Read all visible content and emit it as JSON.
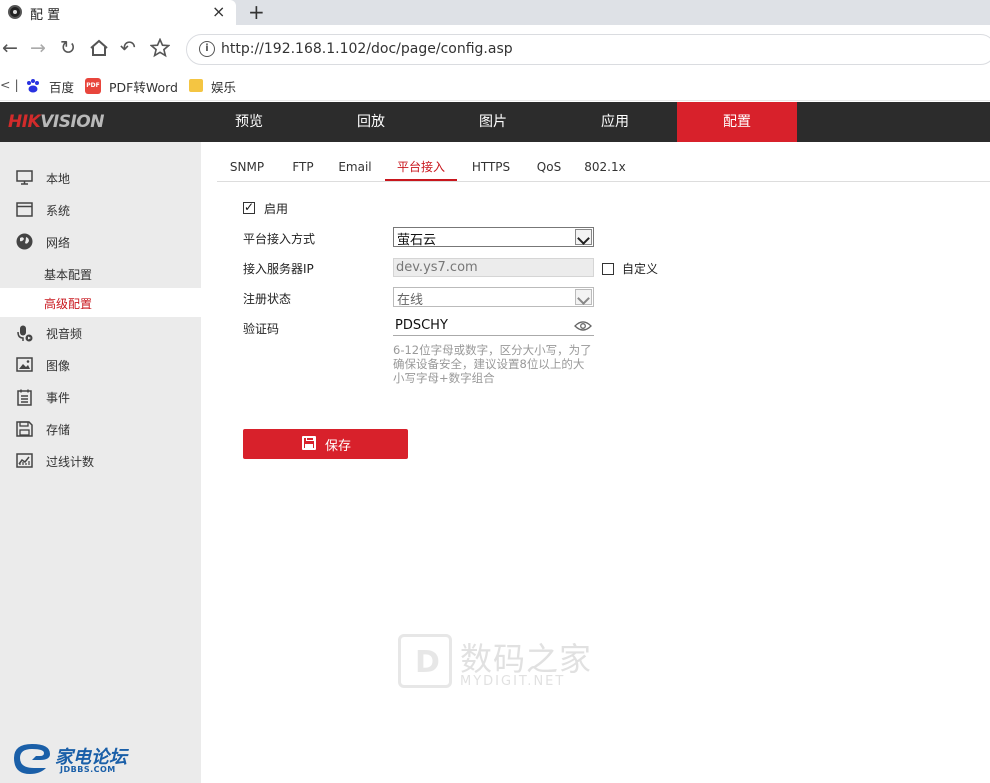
{
  "browser": {
    "tab_title": "配 置",
    "tab_close": "×",
    "new_tab": "+",
    "url": "http://192.168.1.102/doc/page/config.asp",
    "bookmarks": [
      "百度",
      "PDF转Word",
      "娱乐"
    ],
    "bookmark_collapse": "< |"
  },
  "app": {
    "logo_red": "HIK",
    "logo_gray": "VISION",
    "nav": [
      "预览",
      "回放",
      "图片",
      "应用",
      "配置"
    ],
    "nav_active": "配置"
  },
  "sidebar": {
    "items": [
      {
        "label": "本地",
        "icon": "monitor-icon"
      },
      {
        "label": "系统",
        "icon": "window-icon"
      },
      {
        "label": "网络",
        "icon": "globe-icon"
      },
      {
        "label": "基本配置",
        "sub": true
      },
      {
        "label": "高级配置",
        "sub": true,
        "active": true
      },
      {
        "label": "视音频",
        "icon": "mic-icon"
      },
      {
        "label": "图像",
        "icon": "image-icon"
      },
      {
        "label": "事件",
        "icon": "list-icon"
      },
      {
        "label": "存储",
        "icon": "disk-icon"
      },
      {
        "label": "过线计数",
        "icon": "chart-icon"
      }
    ],
    "footer_logo": "家电论坛",
    "footer_sub": "JDBBS.COM"
  },
  "subtabs": {
    "items": [
      "SNMP",
      "FTP",
      "Email",
      "平台接入",
      "HTTPS",
      "QoS",
      "802.1x"
    ],
    "active": "平台接入"
  },
  "form": {
    "enable_label": "启用",
    "enable_checked": true,
    "platform_label": "平台接入方式",
    "platform_value": "萤石云",
    "server_label": "接入服务器IP",
    "server_value": "dev.ys7.com",
    "custom_label": "自定义",
    "custom_checked": false,
    "status_label": "注册状态",
    "status_value": "在线",
    "code_label": "验证码",
    "code_value": "PDSCHY",
    "hint": "6-12位字母或数字，区分大小写，为了确保设备安全，建议设置8位以上的大小写字母+数字组合",
    "save_label": "保存"
  },
  "watermark": {
    "text": "数码之家",
    "sub": "MYDIGIT.NET"
  }
}
